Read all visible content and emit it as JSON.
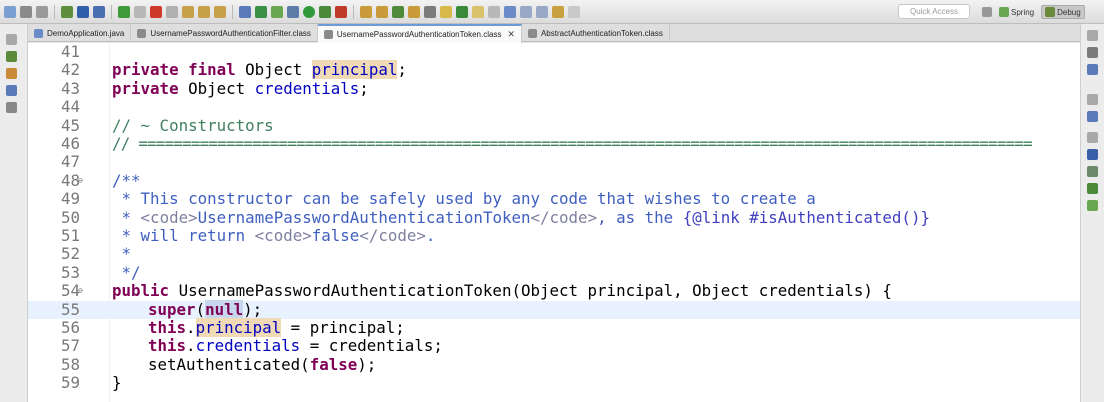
{
  "toolbar": {
    "quick_access_placeholder": "Quick Access",
    "perspectives": [
      {
        "label": "Spring",
        "icon": "spring-leaf-icon"
      },
      {
        "label": "Debug",
        "icon": "debug-icon"
      }
    ]
  },
  "tabs": [
    {
      "label": "DemoApplication.java",
      "icon": "java-file-icon"
    },
    {
      "label": "UsernamePasswordAuthenticationFilter.class",
      "icon": "class-file-icon"
    },
    {
      "label": "UsernamePasswordAuthenticationToken.class",
      "icon": "class-file-icon",
      "active": true,
      "close": "✕"
    },
    {
      "label": "AbstractAuthenticationToken.class",
      "icon": "class-file-icon"
    }
  ],
  "editor": {
    "line_numbers": [
      "41",
      "42",
      "43",
      "44",
      "45",
      "46",
      "47",
      "48",
      "49",
      "50",
      "51",
      "52",
      "53",
      "54",
      "55",
      "56",
      "57",
      "58",
      "59"
    ],
    "current_line": "55",
    "lines": {
      "l42": {
        "kw1": "private",
        "kw2": "final",
        "pre": " Object ",
        "field": "principal",
        "post": ";"
      },
      "l43": {
        "kw1": "private",
        "pre": " Object ",
        "field": "credentials",
        "post": ";"
      },
      "l45": {
        "text": "// ~ Constructors"
      },
      "l46": {
        "text": "// ======================================================================================================"
      },
      "l48": {
        "text": "/**"
      },
      "l49": {
        "text": " * This constructor can be safely used by any code that wishes to create a"
      },
      "l50": {
        "star": " * ",
        "tag_open": "<code>",
        "class_name": "UsernamePasswordAuthenticationToken",
        "tag_close": "</code>",
        "mid": ", as the ",
        "link": "{@link #isAuthenticated()}"
      },
      "l51": {
        "pre": " * will return ",
        "tag_open": "<code>",
        "value": "false",
        "tag_close": "</code>",
        "post": "."
      },
      "l52": {
        "text": " *"
      },
      "l53": {
        "text": " */"
      },
      "l54": {
        "kw": "public",
        "text": " UsernamePasswordAuthenticationToken(Object principal, Object credentials) {"
      },
      "l55": {
        "kw": "super",
        "open": "(",
        "arg": "null",
        "close": ");"
      },
      "l56": {
        "kw": "this",
        "dot": ".",
        "field": "principal",
        "post": " = principal;"
      },
      "l57": {
        "kw": "this",
        "dot": ".",
        "field": "credentials",
        "post": " = credentials;"
      },
      "l58": {
        "pre": "setAuthenticated(",
        "kw": "false",
        "post": ");"
      },
      "l59": {
        "text": "}"
      }
    }
  }
}
